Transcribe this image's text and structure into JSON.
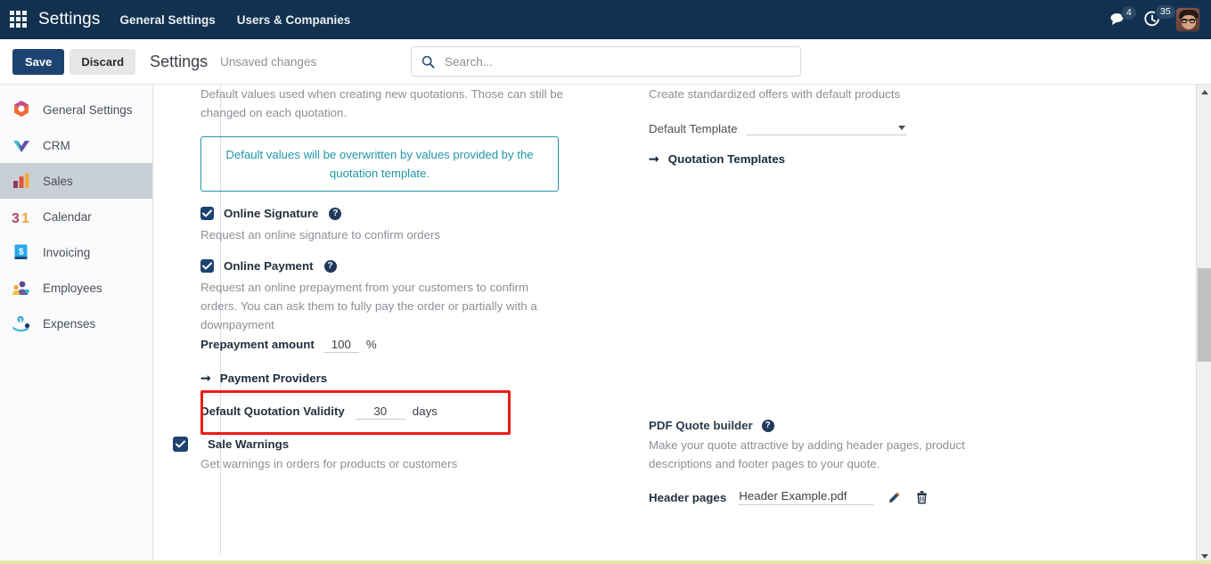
{
  "navbar": {
    "apps_icon": "apps-grid-icon",
    "brand": "Settings",
    "links": [
      {
        "label": "General Settings"
      },
      {
        "label": "Users & Companies"
      }
    ],
    "messages_icon": "chat-bubble-icon",
    "messages_count": "4",
    "activities_icon": "clock-icon",
    "activities_count": "35",
    "avatar": "user-avatar"
  },
  "control_panel": {
    "save_label": "Save",
    "discard_label": "Discard",
    "title": "Settings",
    "dirty_label": "Unsaved changes"
  },
  "search": {
    "icon": "search-icon",
    "placeholder": "Search...",
    "value": ""
  },
  "sidebar": {
    "items": [
      {
        "label": "General Settings",
        "icon": "general-settings-icon",
        "active": false
      },
      {
        "label": "CRM",
        "icon": "crm-icon",
        "active": false
      },
      {
        "label": "Sales",
        "icon": "sales-icon",
        "active": true
      },
      {
        "label": "Calendar",
        "icon": "calendar-icon",
        "active": false
      },
      {
        "label": "Invoicing",
        "icon": "invoicing-icon",
        "active": false
      },
      {
        "label": "Employees",
        "icon": "employees-icon",
        "active": false
      },
      {
        "label": "Expenses",
        "icon": "expenses-icon",
        "active": false
      }
    ]
  },
  "main": {
    "left_column": {
      "intro_text": "Default values used when creating new quotations. Those can still be changed on each quotation.",
      "alert_text": "Default values will be overwritten by values provided by the quotation template.",
      "online_signature": {
        "label": "Online Signature",
        "checked": true,
        "help_icon": "question-mark-icon",
        "description": "Request an online signature to confirm orders"
      },
      "online_payment": {
        "label": "Online Payment",
        "checked": true,
        "help_icon": "question-mark-icon",
        "description": "Request an online prepayment from your customers to confirm orders. You can ask them to fully pay the order or partially with a downpayment"
      },
      "prepayment_amount": {
        "label": "Prepayment amount",
        "value": "100",
        "unit": "%"
      },
      "payment_providers_link": {
        "label": "Payment Providers",
        "icon": "arrow-right-icon"
      },
      "quotation_validity": {
        "label": "Default Quotation Validity",
        "value": "30",
        "unit": "days",
        "highlighted": true
      },
      "sale_warnings": {
        "label": "Sale Warnings",
        "checked": true,
        "description": "Get warnings in orders for products or customers"
      }
    },
    "right_column": {
      "templates_description": "Create standardized offers with default products",
      "default_template": {
        "label": "Default Template",
        "value": "",
        "caret_icon": "chevron-down-icon"
      },
      "quotation_templates_link": {
        "label": "Quotation Templates",
        "icon": "arrow-right-icon"
      },
      "pdf_quote_builder": {
        "label": "PDF Quote builder",
        "help_icon": "question-mark-icon",
        "description": "Make your quote attractive by adding header pages, product descriptions and footer pages to your quote.",
        "header_pages_label": "Header pages",
        "header_pages_file": "Header Example.pdf",
        "edit_icon": "pencil-icon",
        "delete_icon": "trash-icon"
      }
    }
  },
  "scrollbar": {
    "up_icon": "caret-up-icon",
    "down_icon": "caret-down-icon"
  },
  "colors": {
    "navbar_bg": "#11314f",
    "accent": "#1d4370",
    "alert_border": "#2095aa",
    "highlight_red": "#ee1b15",
    "sidebar_active": "#c9cfd6"
  }
}
